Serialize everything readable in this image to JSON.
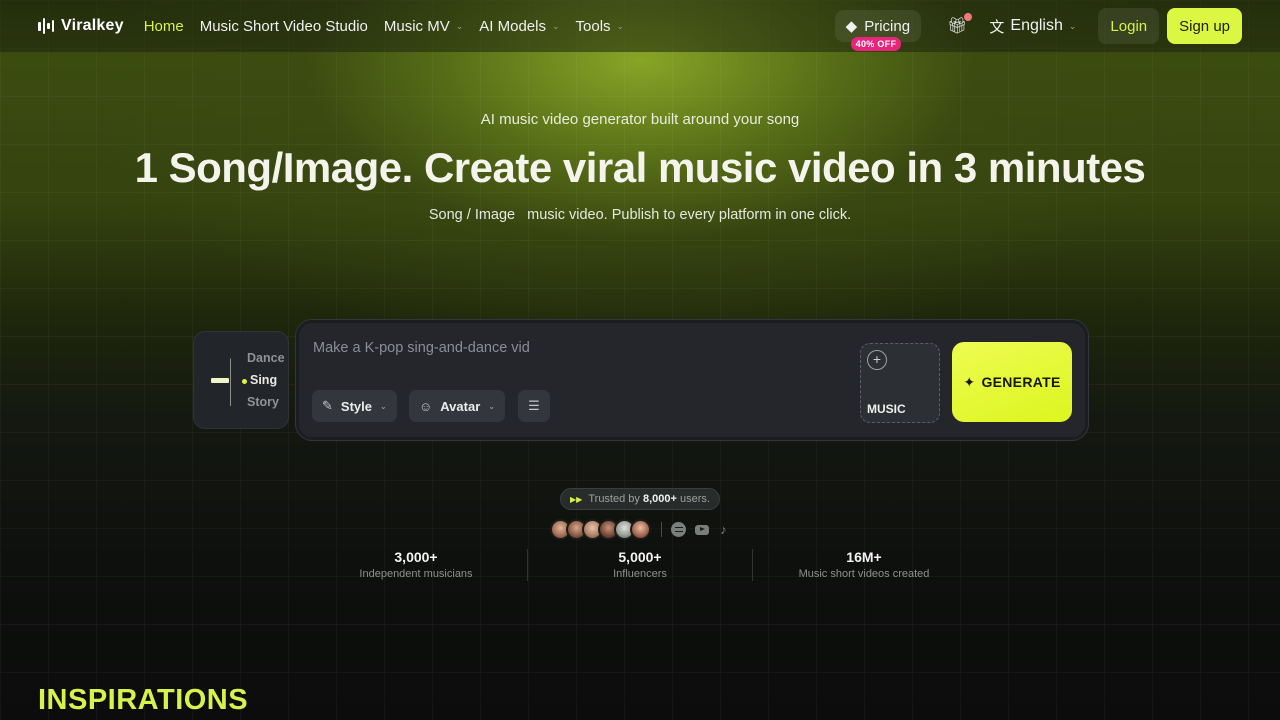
{
  "brand": {
    "name": "Viralkey",
    "icon": "soundwave-logo-icon"
  },
  "nav": {
    "items": [
      {
        "label": "Home",
        "active": true,
        "dropdown": false
      },
      {
        "label": "Music Short Video Studio",
        "active": false,
        "dropdown": false
      },
      {
        "label": "Music MV",
        "active": false,
        "dropdown": true
      },
      {
        "label": "AI Models",
        "active": false,
        "dropdown": true
      },
      {
        "label": "Tools",
        "active": false,
        "dropdown": true
      }
    ],
    "pricing": {
      "label": "Pricing",
      "badge": "40% OFF",
      "icon": "diamond-icon"
    },
    "gift_icon": "gift-icon",
    "language": {
      "label": "English",
      "icon": "translate-icon"
    },
    "login": "Login",
    "signup": "Sign up"
  },
  "hero": {
    "subtitle": "AI music video generator built around your song",
    "title": "1 Song/Image. Create viral music video in 3 minutes",
    "desc_part1": "Song / Image",
    "desc_part2": "music video. Publish to every platform in one click."
  },
  "modes": {
    "items": [
      "Dance",
      "Sing",
      "Story"
    ],
    "selected": "Sing"
  },
  "prompt": {
    "placeholder": "Make a K-pop sing-and-dance vid",
    "value": "",
    "style_label": "Style",
    "avatar_label": "Avatar",
    "music_label": "MUSIC",
    "generate_label": "GENERATE"
  },
  "trust": {
    "prefix": "Trusted by",
    "count": "8,000+",
    "suffix": "users.",
    "platforms": [
      "spotify-icon",
      "youtube-icon",
      "tiktok-icon"
    ]
  },
  "stats": [
    {
      "value": "3,000+",
      "label": "Independent musicians"
    },
    {
      "value": "5,000+",
      "label": "Influencers"
    },
    {
      "value": "16M+",
      "label": "Music short videos created"
    }
  ],
  "section_title": "INSPIRATIONS",
  "colors": {
    "accent": "#dcf742",
    "badge": "#e8257a",
    "background": "#0d0f0d"
  }
}
